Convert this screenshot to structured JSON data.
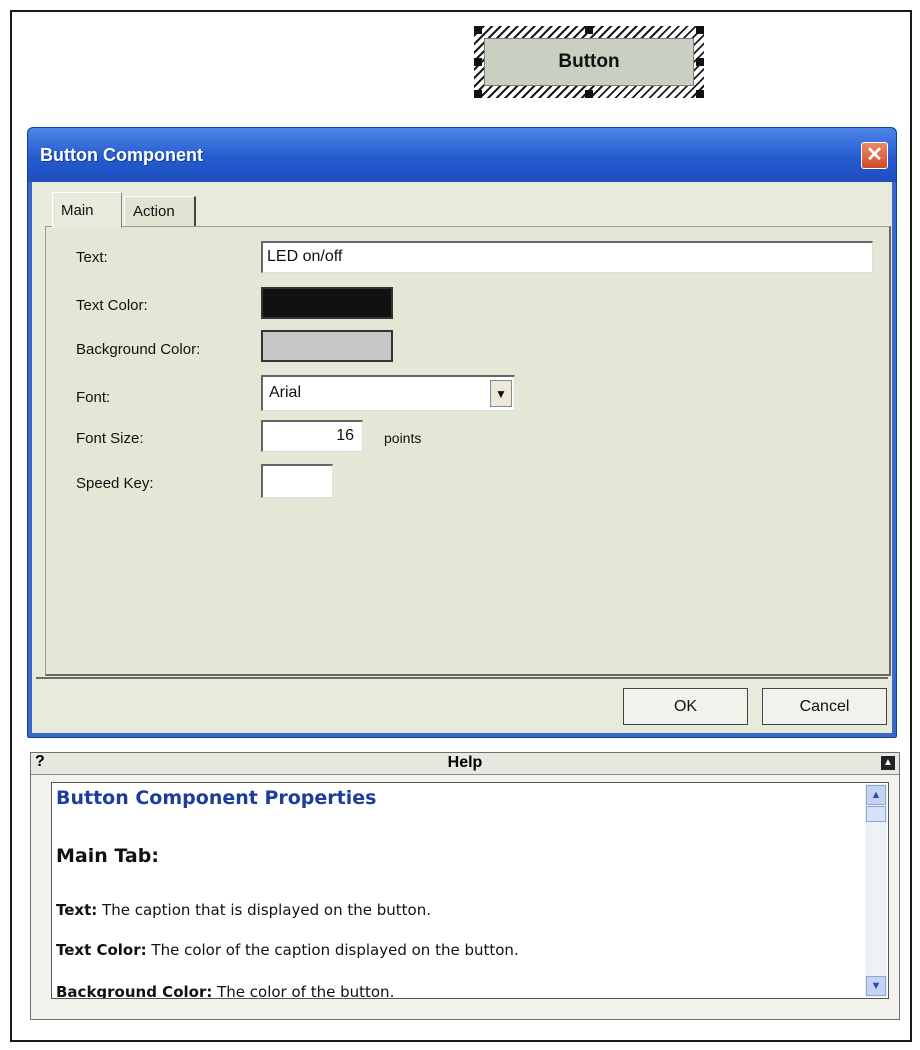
{
  "canvas": {
    "selected_button_label": "Button"
  },
  "dialog": {
    "title": "Button Component",
    "close_glyph": "✕",
    "tabs": [
      {
        "label": "Main",
        "active": true
      },
      {
        "label": "Action",
        "active": false
      }
    ],
    "fields": {
      "text": {
        "label": "Text:",
        "value": "LED on/off"
      },
      "text_color": {
        "label": "Text Color:",
        "color": "#111111"
      },
      "background_color": {
        "label": "Background Color:",
        "color": "#c6c6c6"
      },
      "font": {
        "label": "Font:",
        "value": "Arial",
        "icon": "chevron-down-icon"
      },
      "font_size": {
        "label": "Font Size:",
        "value": "16",
        "unit": "points"
      },
      "speed_key": {
        "label": "Speed Key:",
        "value": ""
      }
    },
    "buttons": {
      "ok": "OK",
      "cancel": "Cancel"
    }
  },
  "help": {
    "question_mark": "?",
    "title": "Help",
    "heading": "Button Component Properties",
    "subheading": "Main Tab:",
    "items": [
      {
        "term": "Text:",
        "desc": " The caption that is displayed on the button."
      },
      {
        "term": "Text Color:",
        "desc": " The color of the caption displayed on the button."
      },
      {
        "term": "Background Color:",
        "desc": " The color of the button."
      }
    ]
  }
}
